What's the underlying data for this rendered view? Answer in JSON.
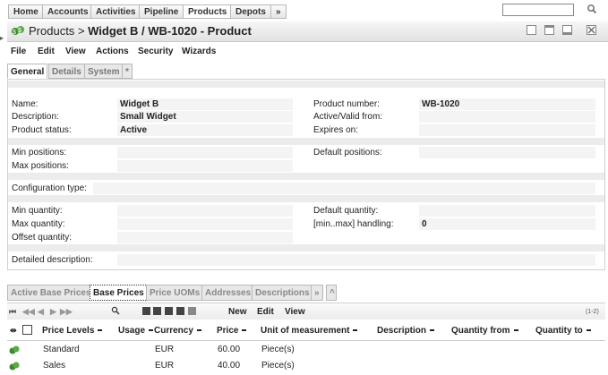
{
  "nav": {
    "tabs": [
      "Home",
      "Accounts",
      "Activities",
      "Pipeline",
      "Products",
      "Depots",
      "»"
    ],
    "active": "Products",
    "search_value": ""
  },
  "header": {
    "breadcrumb_root": "Products",
    "separator": ">",
    "title": "Widget B / WB-1020 - Product"
  },
  "menu": [
    "File",
    "Edit",
    "View",
    "Actions",
    "Security",
    "Wizards"
  ],
  "subtabs": [
    "General",
    "Details",
    "System",
    "*"
  ],
  "form": {
    "name_label": "Name:",
    "name_value": "Widget B",
    "description_label": "Description:",
    "description_value": "Small Widget",
    "status_label": "Product status:",
    "status_value": "Active",
    "number_label": "Product number:",
    "number_value": "WB-1020",
    "valid_from_label": "Active/Valid from:",
    "expires_label": "Expires on:",
    "min_positions_label": "Min positions:",
    "max_positions_label": "Max positions:",
    "default_positions_label": "Default positions:",
    "config_type_label": "Configuration type:",
    "min_qty_label": "Min quantity:",
    "max_qty_label": "Max quantity:",
    "offset_qty_label": "Offset quantity:",
    "default_qty_label": "Default quantity:",
    "minmax_label": "[min..max] handling:",
    "minmax_value": "0",
    "detailed_desc_label": "Detailed description:"
  },
  "bottom_tabs": [
    "Active Base Prices",
    "Base Prices",
    "Price UOMs",
    "Addresses",
    "Descriptions",
    "»",
    "^"
  ],
  "bottom_active": "Base Prices",
  "toolbar": {
    "new_label": "New",
    "edit_label": "Edit",
    "view_label": "View",
    "range": "(1-2)"
  },
  "grid": {
    "columns": [
      "Price Levels",
      "Usage",
      "Currency",
      "Price",
      "Unit of measurement",
      "Description",
      "Quantity from",
      "Quantity to"
    ],
    "rows": [
      {
        "price_level": "Standard",
        "usage": "",
        "currency": "EUR",
        "price": "60.00",
        "uom": "Piece(s)"
      },
      {
        "price_level": "Sales",
        "usage": "",
        "currency": "EUR",
        "price": "40.00",
        "uom": "Piece(s)"
      }
    ]
  },
  "colors": {
    "accent_green": "#3a8a2a",
    "band": "#ececec"
  }
}
